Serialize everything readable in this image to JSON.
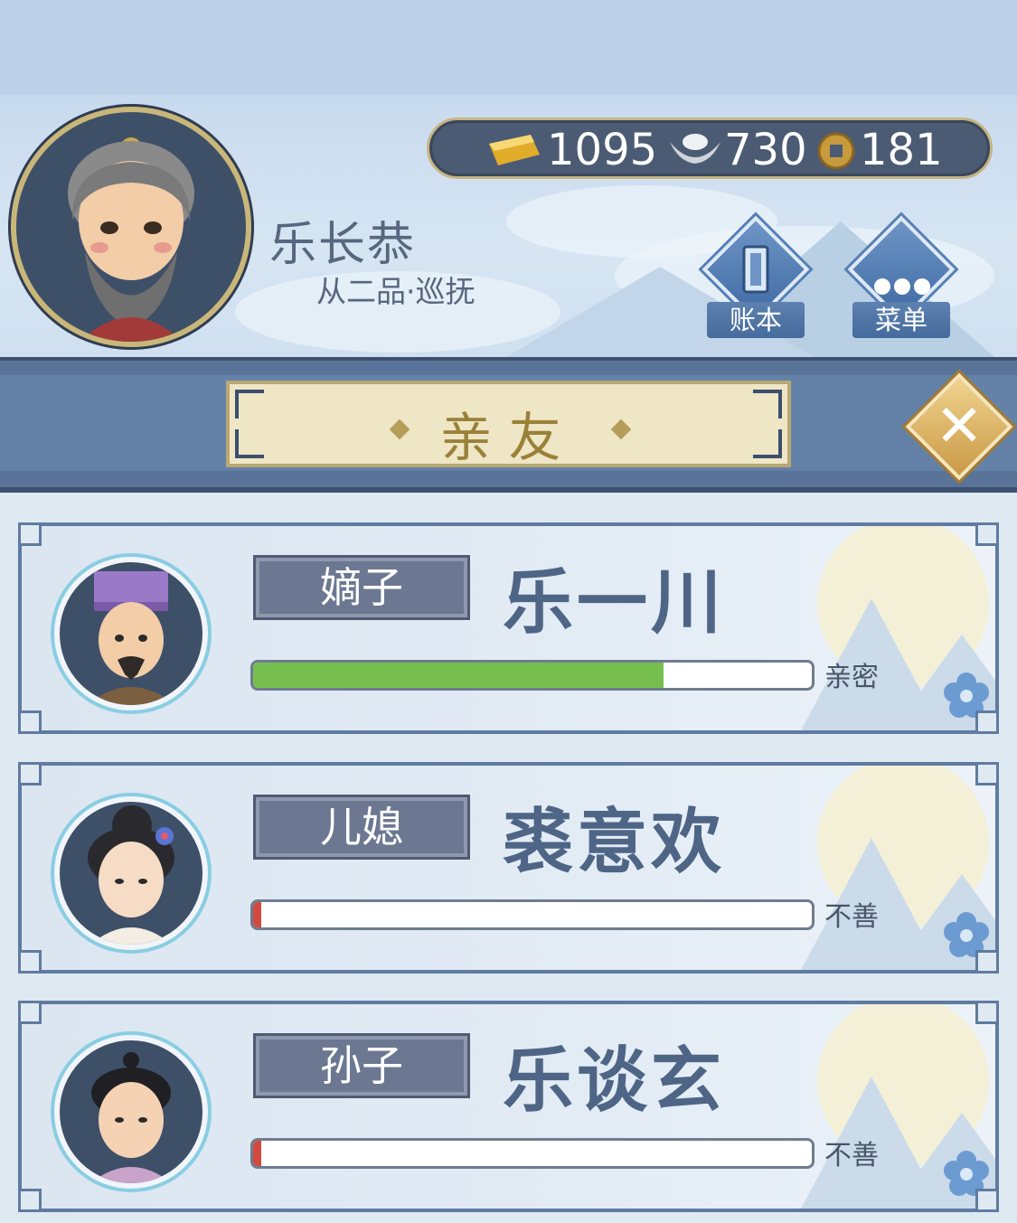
{
  "player": {
    "name": "乐长恭",
    "rank": "从二品·巡抚"
  },
  "currency": {
    "gold": "1095",
    "silver": "730",
    "coin": "181"
  },
  "actions": {
    "ledger_label": "账本",
    "menu_label": "菜单"
  },
  "panel": {
    "title": "亲友",
    "close_icon": "close-x-icon"
  },
  "relatives": [
    {
      "relation": "嫡子",
      "name": "乐一川",
      "affinity_label": "亲密",
      "affinity_fraction": 0.735
    },
    {
      "relation": "儿媳",
      "name": "裘意欢",
      "affinity_label": "不善",
      "affinity_fraction": 0.015
    },
    {
      "relation": "孙子",
      "name": "乐谈玄",
      "affinity_label": "不善",
      "affinity_fraction": 0.015
    }
  ],
  "colors": {
    "affinity_high": "#76bf4f",
    "affinity_low": "#d3493f",
    "accent_blue": "#5a7499",
    "accent_gold": "#c7b483"
  }
}
